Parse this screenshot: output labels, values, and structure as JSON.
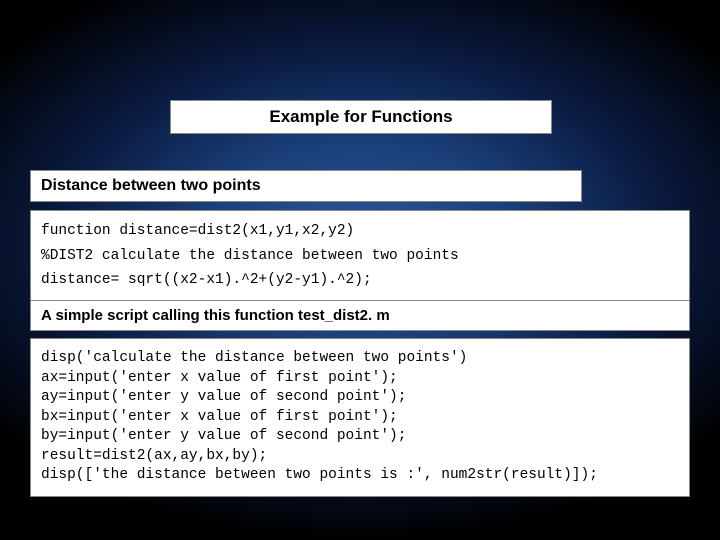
{
  "title": "Example for Functions",
  "subtitle": "Distance between two points",
  "func_code": "function distance=dist2(x1,y1,x2,y2)\n%DIST2 calculate the distance between two points\ndistance= sqrt((x2-x1).^2+(y2-y1).^2);",
  "script_title": "A simple script calling this function test_dist2. m",
  "script_code": "disp('calculate the distance between two points')\nax=input('enter x value of first point');\nay=input('enter y value of second point');\nbx=input('enter x value of first point');\nby=input('enter y value of second point');\nresult=dist2(ax,ay,bx,by);\ndisp(['the distance between two points is :', num2str(result)]);"
}
